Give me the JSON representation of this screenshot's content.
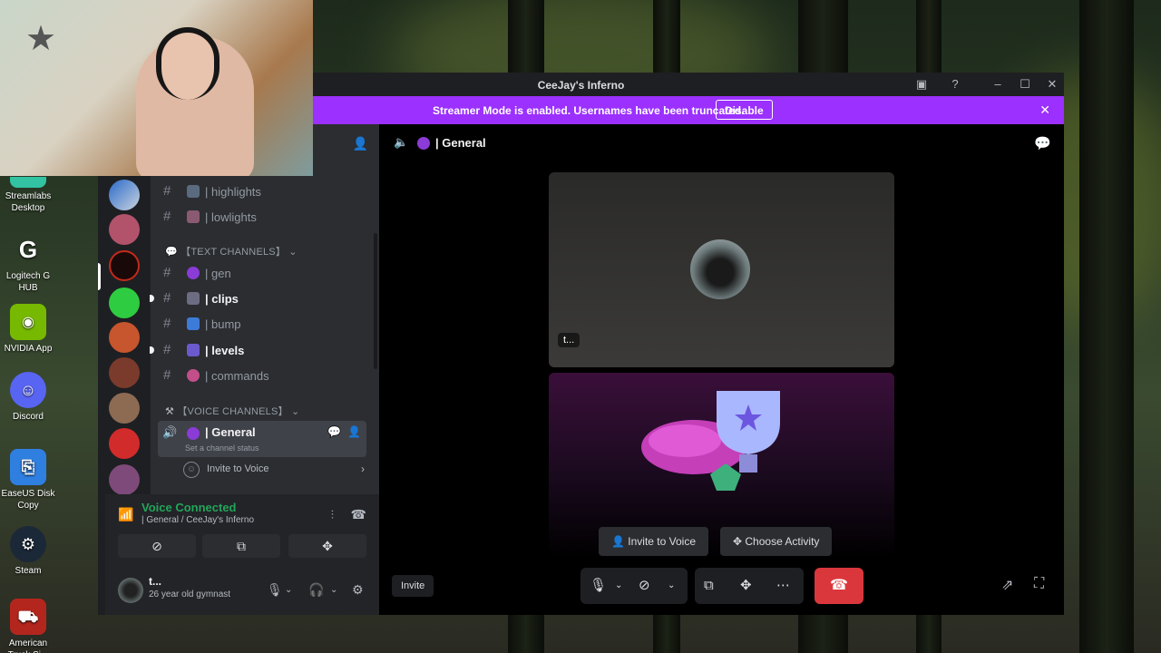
{
  "window": {
    "title": "CeeJay's Inferno"
  },
  "streamer_bar": {
    "message": "Streamer Mode is enabled. Usernames have been truncated.",
    "disable_label": "Disable"
  },
  "desktop_icons": [
    {
      "label": "Streamlabs Desktop",
      "color": "#31c3a2"
    },
    {
      "label": "Logitech G HUB",
      "color": "#1a1a1a"
    },
    {
      "label": "NVIDIA App",
      "color": "#76b900"
    },
    {
      "label": "Discord",
      "color": "#5865f2"
    },
    {
      "label": "EaseUS Disk Copy",
      "color": "#2f7fe0"
    },
    {
      "label": "Steam",
      "color": "#1b2838"
    },
    {
      "label": "American Truck Si...",
      "color": "#b3261e"
    }
  ],
  "channels": [
    {
      "name": "| highlights",
      "unread": false
    },
    {
      "name": "| lowlights",
      "unread": false
    },
    {
      "name": "| gen",
      "unread": false
    },
    {
      "name": "| clips",
      "unread": true
    },
    {
      "name": "| bump",
      "unread": false
    },
    {
      "name": "| levels",
      "unread": true
    },
    {
      "name": "| commands",
      "unread": false
    }
  ],
  "categories": {
    "text": "【TEXT CHANNELS】",
    "voice": "【VOICE CHANNELS】"
  },
  "voice_channel": {
    "name": "| General",
    "status_placeholder": "Set a channel status",
    "invite": "Invite to Voice"
  },
  "voice_panel": {
    "status": "Voice Connected",
    "location": "| General / CeeJay's Inferno"
  },
  "user": {
    "name": "t...",
    "subtitle": "26 year old gymnast"
  },
  "main": {
    "channel_title": "| General",
    "tile_name": "t...",
    "invite_voice": "Invite to Voice",
    "choose_activity": "Choose Activity",
    "invite": "Invite"
  }
}
